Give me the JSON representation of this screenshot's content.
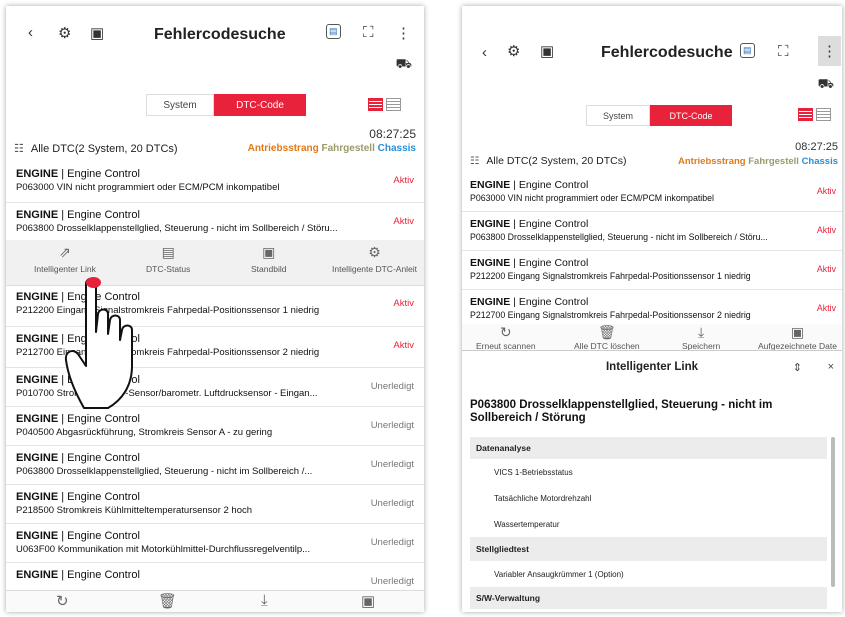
{
  "left": {
    "header": {
      "back": "‹",
      "title": "Fehlercodesuche",
      "more": "⋮"
    },
    "tabs": {
      "system": "System",
      "dtc": "DTC-Code"
    },
    "time": "08:27:25",
    "summary": "Alle DTC(2 System, 20 DTCs)",
    "filters": {
      "f1": "Antriebsstrang",
      "f2": "Fahrgestell",
      "f3": "Chassis"
    },
    "rows": [
      {
        "system": "ENGINE",
        "sub": " | Engine Control",
        "desc": "P063000 VIN nicht programmiert oder ECM/PCM inkompatibel",
        "status": "Aktiv"
      },
      {
        "system": "ENGINE",
        "sub": " | Engine Control",
        "desc": "P063800 Drosselklappenstellglied, Steuerung - nicht im Sollbereich / Störu...",
        "status": "Aktiv"
      },
      {
        "system": "ENGINE",
        "sub": " | Engine Control",
        "desc": "P212200 Eingang Signalstromkreis Fahrpedal-Positionssensor 1 niedrig",
        "status": "Aktiv"
      },
      {
        "system": "ENGINE",
        "sub": " | Engine Control",
        "desc": "P212700 Eingang Signalstromkreis Fahrpedal-Positionssensor 2 niedrig",
        "status": "Aktiv"
      },
      {
        "system": "ENGINE",
        "sub": " | Engine Control",
        "desc": "P010700 Stromkreis MAP-Sensor/barometr. Luftdrucksensor - Eingan...",
        "status": "Unerledigt"
      },
      {
        "system": "ENGINE",
        "sub": " | Engine Control",
        "desc": "P040500 Abgasrückführung, Stromkreis Sensor A - zu gering",
        "status": "Unerledigt"
      },
      {
        "system": "ENGINE",
        "sub": " | Engine Control",
        "desc": "P063800 Drosselklappenstellglied, Steuerung - nicht im Sollbereich /...",
        "status": "Unerledigt"
      },
      {
        "system": "ENGINE",
        "sub": " | Engine Control",
        "desc": "P218500 Stromkreis Kühlmitteltemperatursensor 2 hoch",
        "status": "Unerledigt"
      },
      {
        "system": "ENGINE",
        "sub": " | Engine Control",
        "desc": "U063F00 Kommunikation mit Motorkühlmittel-Durchflussregelventilp...",
        "status": "Unerledigt"
      },
      {
        "system": "ENGINE",
        "sub": " | Engine Control",
        "desc": "",
        "status": "Unerledigt"
      }
    ],
    "actions": [
      "Intelligenter Link",
      "DTC-Status",
      "Standbild",
      "Intelligente DTC-Anleit"
    ]
  },
  "right": {
    "header": {
      "back": "‹",
      "title": "Fehlercodesuche",
      "more": "⋮"
    },
    "tabs": {
      "system": "System",
      "dtc": "DTC-Code"
    },
    "time": "08:27:25",
    "summary": "Alle DTC(2 System, 20 DTCs)",
    "filters": {
      "f1": "Antriebsstrang",
      "f2": "Fahrgestell",
      "f3": "Chassis"
    },
    "rows": [
      {
        "system": "ENGINE",
        "sub": " | Engine Control",
        "desc": "P063000 VIN nicht programmiert oder ECM/PCM inkompatibel",
        "status": "Aktiv"
      },
      {
        "system": "ENGINE",
        "sub": " | Engine Control",
        "desc": "P063800 Drosselklappenstellglied, Steuerung - nicht im Sollbereich / Störu...",
        "status": "Aktiv"
      },
      {
        "system": "ENGINE",
        "sub": " | Engine Control",
        "desc": "P212200 Eingang Signalstromkreis Fahrpedal-Positionssensor 1 niedrig",
        "status": "Aktiv"
      },
      {
        "system": "ENGINE",
        "sub": " | Engine Control",
        "desc": "P212700 Eingang Signalstromkreis Fahrpedal-Positionssensor 2 niedrig",
        "status": "Aktiv"
      }
    ],
    "toolbar": [
      "Erneut scannen",
      "Alle DTC löschen",
      "Speichern",
      "Aufgezeichnete Date"
    ],
    "panel": {
      "title": "Intelligenter Link",
      "dtc": "P063800 Drosselklappenstellglied, Steuerung - nicht im Sollbereich / Störung",
      "sections": [
        {
          "label": "Datenanalyse",
          "items": [
            "VICS 1-Betriebsstatus",
            "Tatsächliche Motordrehzahl",
            "Wassertemperatur"
          ]
        },
        {
          "label": "Stellgliedtest",
          "items": [
            "Variabler Ansaugkrümmer 1 (Option)"
          ]
        },
        {
          "label": "S/W-Verwaltung",
          "items": []
        }
      ]
    }
  }
}
